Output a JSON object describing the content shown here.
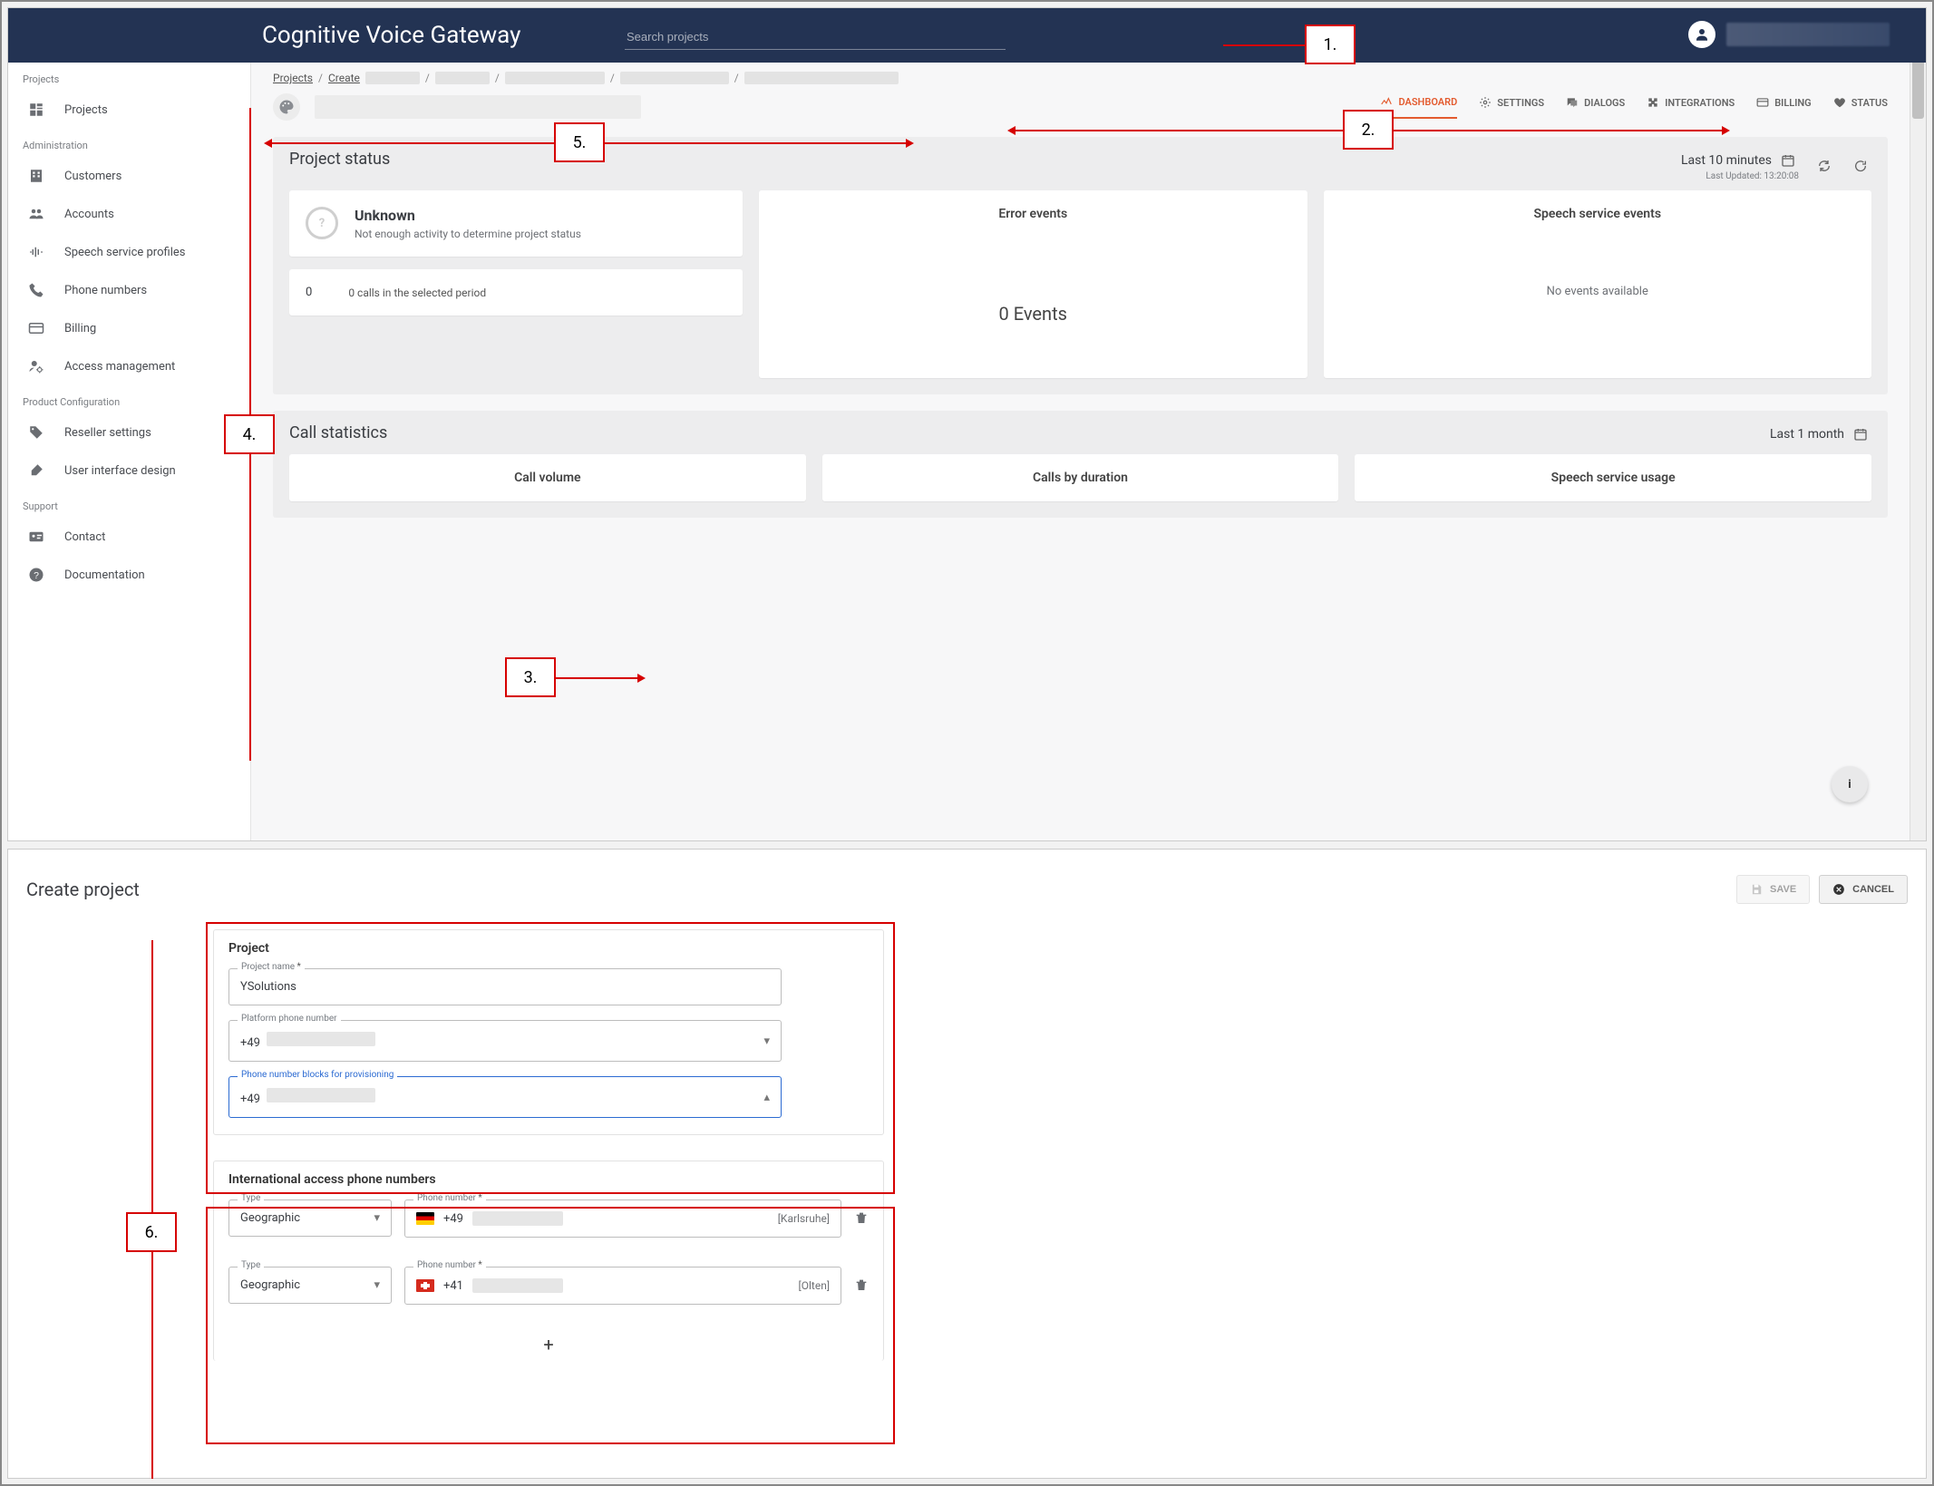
{
  "annotations": {
    "a1": "1.",
    "a2": "2.",
    "a3": "3.",
    "a4": "4.",
    "a5": "5.",
    "a6": "6."
  },
  "header": {
    "brand": "Cognitive Voice Gateway",
    "search_placeholder": "Search projects"
  },
  "sidebar": {
    "sections": [
      {
        "label": "Projects",
        "items": [
          {
            "key": "projects",
            "label": "Projects",
            "icon": "grid"
          }
        ]
      },
      {
        "label": "Administration",
        "items": [
          {
            "key": "customers",
            "label": "Customers",
            "icon": "building"
          },
          {
            "key": "accounts",
            "label": "Accounts",
            "icon": "users"
          },
          {
            "key": "speech-profiles",
            "label": "Speech service profiles",
            "icon": "waveform"
          },
          {
            "key": "phone-numbers",
            "label": "Phone numbers",
            "icon": "phone"
          },
          {
            "key": "billing",
            "label": "Billing",
            "icon": "card"
          },
          {
            "key": "access-mgmt",
            "label": "Access management",
            "icon": "person-gear"
          }
        ]
      },
      {
        "label": "Product Configuration",
        "items": [
          {
            "key": "reseller",
            "label": "Reseller settings",
            "icon": "tag"
          },
          {
            "key": "ui-design",
            "label": "User interface design",
            "icon": "brush"
          }
        ]
      },
      {
        "label": "Support",
        "items": [
          {
            "key": "contact",
            "label": "Contact",
            "icon": "id-card"
          },
          {
            "key": "documentation",
            "label": "Documentation",
            "icon": "help"
          }
        ]
      }
    ]
  },
  "crumbs": {
    "projects": "Projects",
    "create": "Create"
  },
  "tabs": [
    {
      "key": "dashboard",
      "label": "DASHBOARD",
      "icon": "chart",
      "active": true
    },
    {
      "key": "settings",
      "label": "SETTINGS",
      "icon": "gear"
    },
    {
      "key": "dialogs",
      "label": "DIALOGS",
      "icon": "chat"
    },
    {
      "key": "integrations",
      "label": "INTEGRATIONS",
      "icon": "puzzle"
    },
    {
      "key": "billing",
      "label": "BILLING",
      "icon": "card"
    },
    {
      "key": "status",
      "label": "STATUS",
      "icon": "heart"
    }
  ],
  "project_status": {
    "title": "Project status",
    "range": "Last 10 minutes",
    "last_updated": "Last Updated: 13:20:08",
    "left": {
      "headline": "Unknown",
      "desc": "Not enough activity to determine project status",
      "count": "0",
      "count_desc": "0 calls in the selected period"
    },
    "mid": {
      "title": "Error events",
      "big": "0 Events"
    },
    "right": {
      "title": "Speech service events",
      "empty": "No events available"
    }
  },
  "call_stats": {
    "title": "Call statistics",
    "range": "Last 1 month",
    "cards": {
      "volume": "Call volume",
      "duration": "Calls by duration",
      "speech": "Speech service usage"
    }
  },
  "create": {
    "title": "Create project",
    "save": "SAVE",
    "cancel": "CANCEL",
    "project": {
      "card_title": "Project",
      "name_label": "Project name",
      "name_value": "YSolutions",
      "platform_label": "Platform phone number",
      "platform_value_prefix": "+49",
      "blocks_label": "Phone number blocks for provisioning",
      "blocks_value_prefix": "+49"
    },
    "intl": {
      "card_title": "International access phone numbers",
      "type_label": "Type",
      "type_value": "Geographic",
      "number_label": "Phone number",
      "rows": [
        {
          "flag": "de",
          "prefix": "+49",
          "location": "[Karlsruhe]"
        },
        {
          "flag": "ch",
          "prefix": "+41",
          "location": "[Olten]"
        }
      ],
      "add": "+"
    }
  }
}
